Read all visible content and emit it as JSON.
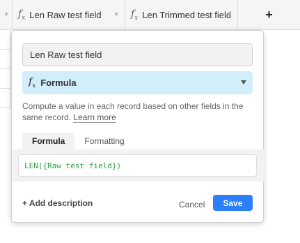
{
  "columns": [
    {
      "label": "Len Raw test field"
    },
    {
      "label": "Len Trimmed test field"
    }
  ],
  "add_column_label": "+",
  "dialog": {
    "field_name": "Len Raw test field",
    "field_type": "Formula",
    "field_type_icon": "formula-fx-icon",
    "description_text": "Compute a value in each record based on other fields in the same record.",
    "learn_more_label": "Learn more",
    "tabs": [
      {
        "label": "Formula",
        "active": true
      },
      {
        "label": "Formatting",
        "active": false
      }
    ],
    "formula_value": "LEN({Raw test field})",
    "add_description_label": "+ Add description",
    "cancel_label": "Cancel",
    "save_label": "Save"
  },
  "colors": {
    "accent": "#2d7ff9",
    "type_select_bg": "#d1eefa",
    "formula_text": "#2e9e3f"
  }
}
